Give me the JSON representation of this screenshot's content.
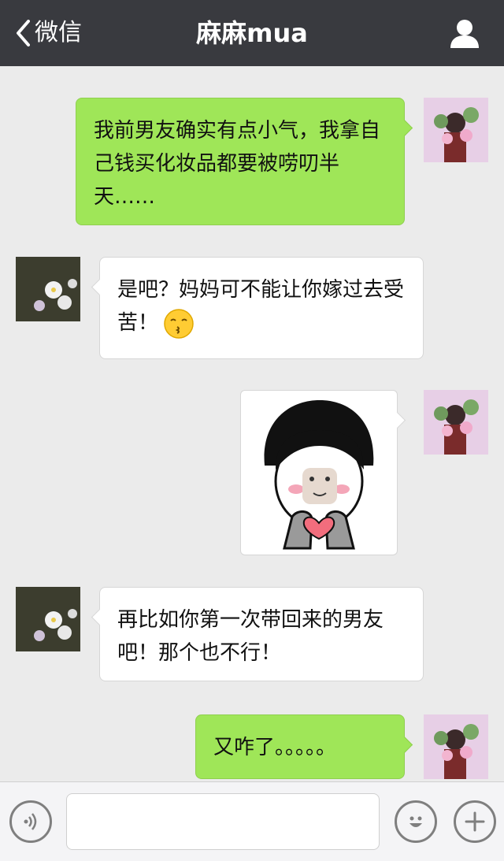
{
  "header": {
    "back_label": "微信",
    "title": "麻麻mua"
  },
  "messages": [
    {
      "side": "right",
      "text": "我前男友确实有点小气，我拿自己钱买化妆品都要被唠叨半天……"
    },
    {
      "side": "left",
      "text": "是吧？妈妈可不能让你嫁过去受苦！",
      "emoji": "kissing-face-emoji"
    },
    {
      "side": "right",
      "type": "sticker",
      "sticker": "bowl-cut-girl-holding-heart-sticker"
    },
    {
      "side": "left",
      "text": "再比如你第一次带回来的男友吧！那个也不行！"
    },
    {
      "side": "right",
      "text": "又咋了。。。。。"
    }
  ],
  "input": {
    "value": ""
  },
  "colors": {
    "topbar": "#393a3f",
    "background": "#ebebeb",
    "sent_bubble": "#9fe658",
    "received_bubble": "#ffffff"
  }
}
